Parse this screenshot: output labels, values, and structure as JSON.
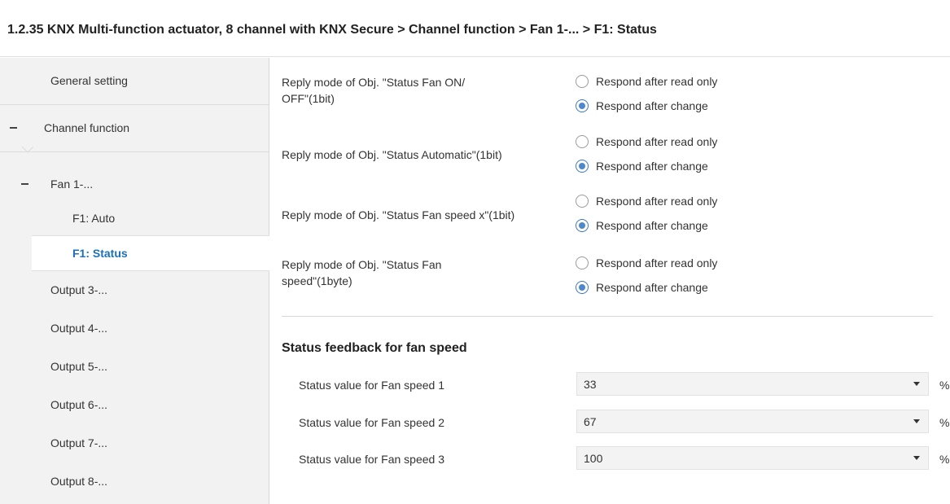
{
  "title": "1.2.35 KNX Multi-function actuator, 8 channel with KNX Secure > Channel function > Fan 1-... > F1: Status",
  "sidebar": {
    "items": [
      {
        "label": "General setting"
      },
      {
        "label": "Channel function",
        "collapse": "−"
      },
      {
        "label": "Fan 1-...",
        "collapse": "−"
      },
      {
        "label": "F1: Auto"
      },
      {
        "label": "F1: Status"
      },
      {
        "label": "Output 3-..."
      },
      {
        "label": "Output 4-..."
      },
      {
        "label": "Output 5-..."
      },
      {
        "label": "Output 6-..."
      },
      {
        "label": "Output 7-..."
      },
      {
        "label": "Output 8-..."
      }
    ]
  },
  "params": [
    {
      "label_line1": "Reply mode of Obj. \"Status Fan ON/",
      "label_line2": "OFF\"(1bit)",
      "options": [
        "Respond after read only",
        "Respond after change"
      ],
      "selected": "Respond after change"
    },
    {
      "label_line1": "Reply mode of Obj. \"Status Automatic\"(1bit)",
      "label_line2": "",
      "options": [
        "Respond after read only",
        "Respond after change"
      ],
      "selected": "Respond after change"
    },
    {
      "label_line1": "Reply mode of Obj. \"Status Fan speed x\"(1bit)",
      "label_line2": "",
      "options": [
        "Respond after read only",
        "Respond after change"
      ],
      "selected": "Respond after change"
    },
    {
      "label_line1": "Reply mode of Obj. \"Status Fan",
      "label_line2": "speed\"(1byte)",
      "options": [
        "Respond after read only",
        "Respond after change"
      ],
      "selected": "Respond after change"
    }
  ],
  "status_section": {
    "title": "Status feedback for fan speed",
    "rows": [
      {
        "label": "Status value for Fan speed 1",
        "value": "33",
        "unit": "%"
      },
      {
        "label": "Status value for Fan speed 2",
        "value": "67",
        "unit": "%"
      },
      {
        "label": "Status value for Fan speed 3",
        "value": "100",
        "unit": "%"
      }
    ]
  },
  "colors": {
    "selected_text": "#1c6fb8",
    "radio_checked": "#4d87cc",
    "sidebar_bg": "#f2f2f2"
  }
}
